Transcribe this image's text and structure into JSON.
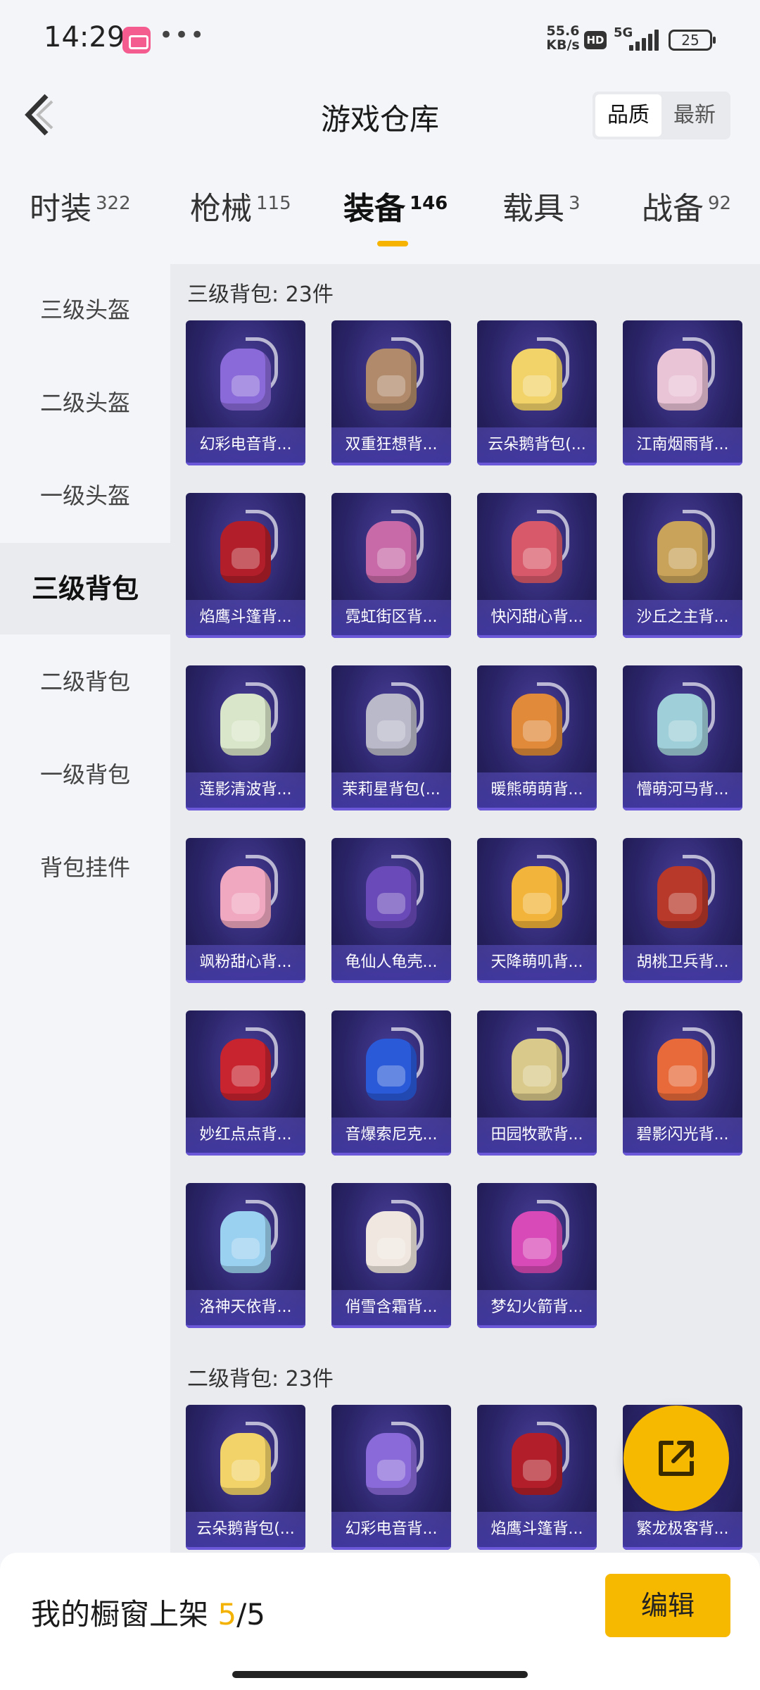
{
  "status_bar": {
    "time": "14:29",
    "dots": "•••",
    "net_speed_value": "55.6",
    "net_speed_unit": "KB/s",
    "hd": "HD",
    "network": "5G",
    "battery": "25"
  },
  "header": {
    "title": "游戏仓库",
    "sort_options": [
      "品质",
      "最新"
    ],
    "sort_active": "品质"
  },
  "tabs": [
    {
      "label": "时装",
      "count": "322"
    },
    {
      "label": "枪械",
      "count": "115"
    },
    {
      "label": "装备",
      "count": "146"
    },
    {
      "label": "载具",
      "count": "3"
    },
    {
      "label": "战备",
      "count": "92"
    }
  ],
  "active_tab": "装备",
  "sidebar": {
    "items": [
      "三级头盔",
      "二级头盔",
      "一级头盔",
      "三级背包",
      "二级背包",
      "一级背包",
      "背包挂件"
    ],
    "active": "三级背包"
  },
  "sections": [
    {
      "title": "三级背包: 23件",
      "items": [
        {
          "name": "幻彩电音背...",
          "color": "#8a6ad8"
        },
        {
          "name": "双重狂想背...",
          "color": "#b08a6a"
        },
        {
          "name": "云朵鹅背包(...",
          "color": "#f2d36a"
        },
        {
          "name": "江南烟雨背...",
          "color": "#e9c3d6"
        },
        {
          "name": "焰鹰斗篷背...",
          "color": "#b21f2a"
        },
        {
          "name": "霓虹街区背...",
          "color": "#c86aa8"
        },
        {
          "name": "快闪甜心背...",
          "color": "#d85a6a"
        },
        {
          "name": "沙丘之主背...",
          "color": "#c9a35a"
        },
        {
          "name": "莲影清波背...",
          "color": "#d9e6c9"
        },
        {
          "name": "茉莉星背包(...",
          "color": "#b9b9c9"
        },
        {
          "name": "暖熊萌萌背...",
          "color": "#e08a3a"
        },
        {
          "name": "懵萌河马背...",
          "color": "#9fcfd8"
        },
        {
          "name": "飒粉甜心背...",
          "color": "#f0a8c0"
        },
        {
          "name": "龟仙人龟壳...",
          "color": "#6a4ab8"
        },
        {
          "name": "天降萌叽背...",
          "color": "#f2b43a"
        },
        {
          "name": "胡桃卫兵背...",
          "color": "#b8382a"
        },
        {
          "name": "妙红点点背...",
          "color": "#c8242f"
        },
        {
          "name": "音爆索尼克...",
          "color": "#2a5ad8"
        },
        {
          "name": "田园牧歌背...",
          "color": "#d9c98a"
        },
        {
          "name": "碧影闪光背...",
          "color": "#e86a3a"
        },
        {
          "name": "洛神天依背...",
          "color": "#9ad0f0"
        },
        {
          "name": "俏雪含霜背...",
          "color": "#f0e8e0"
        },
        {
          "name": "梦幻火箭背...",
          "color": "#d84ab8"
        }
      ]
    },
    {
      "title": "二级背包: 23件",
      "items": [
        {
          "name": "云朵鹅背包(...",
          "color": "#f2d36a"
        },
        {
          "name": "幻彩电音背...",
          "color": "#8a6ad8"
        },
        {
          "name": "焰鹰斗篷背...",
          "color": "#b21f2a"
        },
        {
          "name": "繁龙极客背...",
          "color": "#6a6ad8"
        }
      ]
    }
  ],
  "bottom_bar": {
    "label": "我的橱窗上架",
    "count_current": "5",
    "count_total": "/5",
    "edit_label": "编辑"
  },
  "colors": {
    "accent": "#f7b800",
    "card_bg": "#2a2468"
  }
}
